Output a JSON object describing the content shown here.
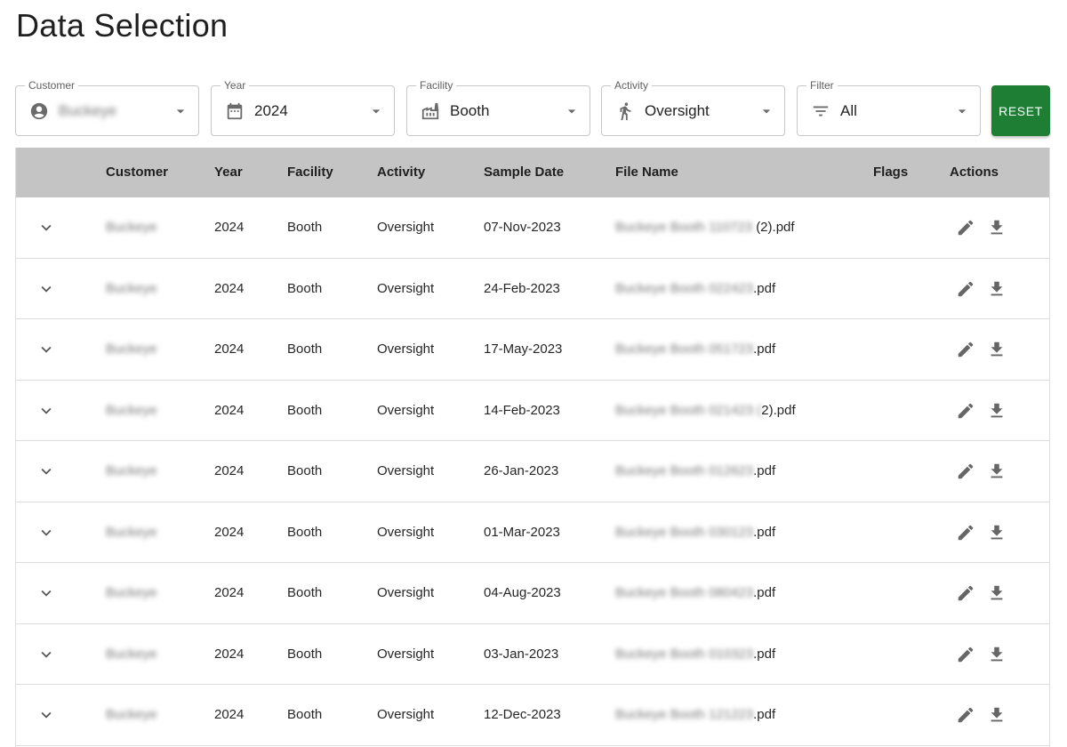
{
  "page": {
    "title": "Data Selection"
  },
  "filters": {
    "customer": {
      "label": "Customer",
      "value": "Buckeye",
      "icon": "account-circle-icon"
    },
    "year": {
      "label": "Year",
      "value": "2024",
      "icon": "calendar-icon"
    },
    "facility": {
      "label": "Facility",
      "value": "Booth",
      "icon": "factory-icon"
    },
    "activity": {
      "label": "Activity",
      "value": "Oversight",
      "icon": "walking-person-icon"
    },
    "filter": {
      "label": "Filter",
      "value": "All",
      "icon": "filter-list-icon"
    },
    "reset_label": "RESET"
  },
  "colors": {
    "reset_button": "#1e7e34",
    "table_header": "#c4c4c4"
  },
  "table": {
    "columns": [
      "Customer",
      "Year",
      "Facility",
      "Activity",
      "Sample Date",
      "File Name",
      "Flags",
      "Actions"
    ],
    "rows": [
      {
        "customer": "Buckeye",
        "year": "2024",
        "facility": "Booth",
        "activity": "Oversight",
        "sample_date": "07-Nov-2023",
        "file_hidden": "Buckeye Booth 110723 ",
        "file_suffix": "(2).pdf",
        "flags": ""
      },
      {
        "customer": "Buckeye",
        "year": "2024",
        "facility": "Booth",
        "activity": "Oversight",
        "sample_date": "24-Feb-2023",
        "file_hidden": "Buckeye Booth 022423",
        "file_suffix": ".pdf",
        "flags": ""
      },
      {
        "customer": "Buckeye",
        "year": "2024",
        "facility": "Booth",
        "activity": "Oversight",
        "sample_date": "17-May-2023",
        "file_hidden": "Buckeye Booth 051723",
        "file_suffix": ".pdf",
        "flags": ""
      },
      {
        "customer": "Buckeye",
        "year": "2024",
        "facility": "Booth",
        "activity": "Oversight",
        "sample_date": "14-Feb-2023",
        "file_hidden": "Buckeye Booth 021423 (",
        "file_suffix": "2).pdf",
        "flags": ""
      },
      {
        "customer": "Buckeye",
        "year": "2024",
        "facility": "Booth",
        "activity": "Oversight",
        "sample_date": "26-Jan-2023",
        "file_hidden": "Buckeye Booth 012623",
        "file_suffix": ".pdf",
        "flags": ""
      },
      {
        "customer": "Buckeye",
        "year": "2024",
        "facility": "Booth",
        "activity": "Oversight",
        "sample_date": "01-Mar-2023",
        "file_hidden": "Buckeye Booth 030123",
        "file_suffix": ".pdf",
        "flags": ""
      },
      {
        "customer": "Buckeye",
        "year": "2024",
        "facility": "Booth",
        "activity": "Oversight",
        "sample_date": "04-Aug-2023",
        "file_hidden": "Buckeye Booth 080423",
        "file_suffix": ".pdf",
        "flags": ""
      },
      {
        "customer": "Buckeye",
        "year": "2024",
        "facility": "Booth",
        "activity": "Oversight",
        "sample_date": "03-Jan-2023",
        "file_hidden": "Buckeye Booth 010323",
        "file_suffix": ".pdf",
        "flags": ""
      },
      {
        "customer": "Buckeye",
        "year": "2024",
        "facility": "Booth",
        "activity": "Oversight",
        "sample_date": "12-Dec-2023",
        "file_hidden": "Buckeye Booth 121223",
        "file_suffix": ".pdf",
        "flags": ""
      }
    ]
  }
}
